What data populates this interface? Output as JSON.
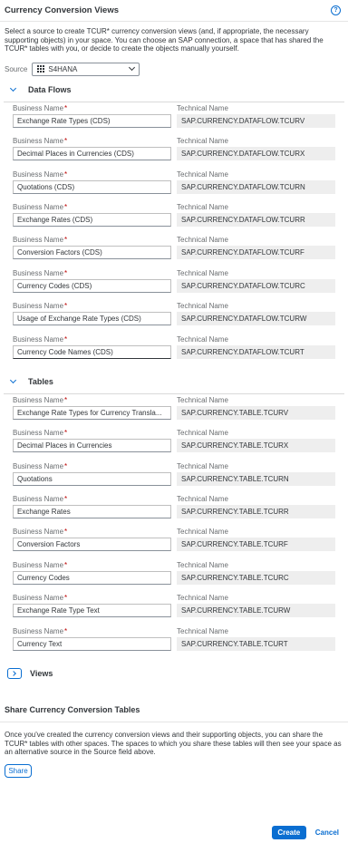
{
  "header": {
    "title": "Currency Conversion Views",
    "help_icon": "help-icon"
  },
  "intro_text": "Select a source to create TCUR* currency conversion views (and, if appropriate, the necessary supporting objects) in your space. You can choose an SAP connection, a space that has shared the TCUR* tables with you, or decide to create the objects manually yourself.",
  "source": {
    "label": "Source",
    "value": "S4HANA"
  },
  "field_labels": {
    "business_name": "Business Name",
    "required_mark": "*",
    "technical_name": "Technical Name"
  },
  "data_flows": {
    "title": "Data Flows",
    "rows": [
      {
        "business": "Exchange Rate Types (CDS)",
        "technical": "SAP.CURRENCY.DATAFLOW.TCURV"
      },
      {
        "business": "Decimal Places in Currencies (CDS)",
        "technical": "SAP.CURRENCY.DATAFLOW.TCURX"
      },
      {
        "business": "Quotations (CDS)",
        "technical": "SAP.CURRENCY.DATAFLOW.TCURN"
      },
      {
        "business": "Exchange Rates (CDS)",
        "technical": "SAP.CURRENCY.DATAFLOW.TCURR"
      },
      {
        "business": "Conversion Factors (CDS)",
        "technical": "SAP.CURRENCY.DATAFLOW.TCURF"
      },
      {
        "business": "Currency Codes (CDS)",
        "technical": "SAP.CURRENCY.DATAFLOW.TCURC"
      },
      {
        "business": "Usage of Exchange Rate Types (CDS)",
        "technical": "SAP.CURRENCY.DATAFLOW.TCURW"
      },
      {
        "business": "Currency Code Names (CDS)",
        "technical": "SAP.CURRENCY.DATAFLOW.TCURT"
      }
    ]
  },
  "tables": {
    "title": "Tables",
    "rows": [
      {
        "business": "Exchange Rate Types for Currency Transla...",
        "technical": "SAP.CURRENCY.TABLE.TCURV"
      },
      {
        "business": "Decimal Places in Currencies",
        "technical": "SAP.CURRENCY.TABLE.TCURX"
      },
      {
        "business": "Quotations",
        "technical": "SAP.CURRENCY.TABLE.TCURN"
      },
      {
        "business": "Exchange Rates",
        "technical": "SAP.CURRENCY.TABLE.TCURR"
      },
      {
        "business": "Conversion Factors",
        "technical": "SAP.CURRENCY.TABLE.TCURF"
      },
      {
        "business": "Currency Codes",
        "technical": "SAP.CURRENCY.TABLE.TCURC"
      },
      {
        "business": "Exchange Rate Type Text",
        "technical": "SAP.CURRENCY.TABLE.TCURW"
      },
      {
        "business": "Currency Text",
        "technical": "SAP.CURRENCY.TABLE.TCURT"
      }
    ]
  },
  "views": {
    "title": "Views"
  },
  "share": {
    "title": "Share Currency Conversion Tables",
    "text": "Once you've created the currency conversion views and their supporting objects, you can share the TCUR* tables with other spaces. The spaces to which you share these tables will then see your space as an alternative source in the Source field above.",
    "button": "Share"
  },
  "footer": {
    "create": "Create",
    "cancel": "Cancel"
  },
  "colors": {
    "accent": "#0a6ed1",
    "required": "#bb0000",
    "readonly_bg": "#eeeeee"
  }
}
